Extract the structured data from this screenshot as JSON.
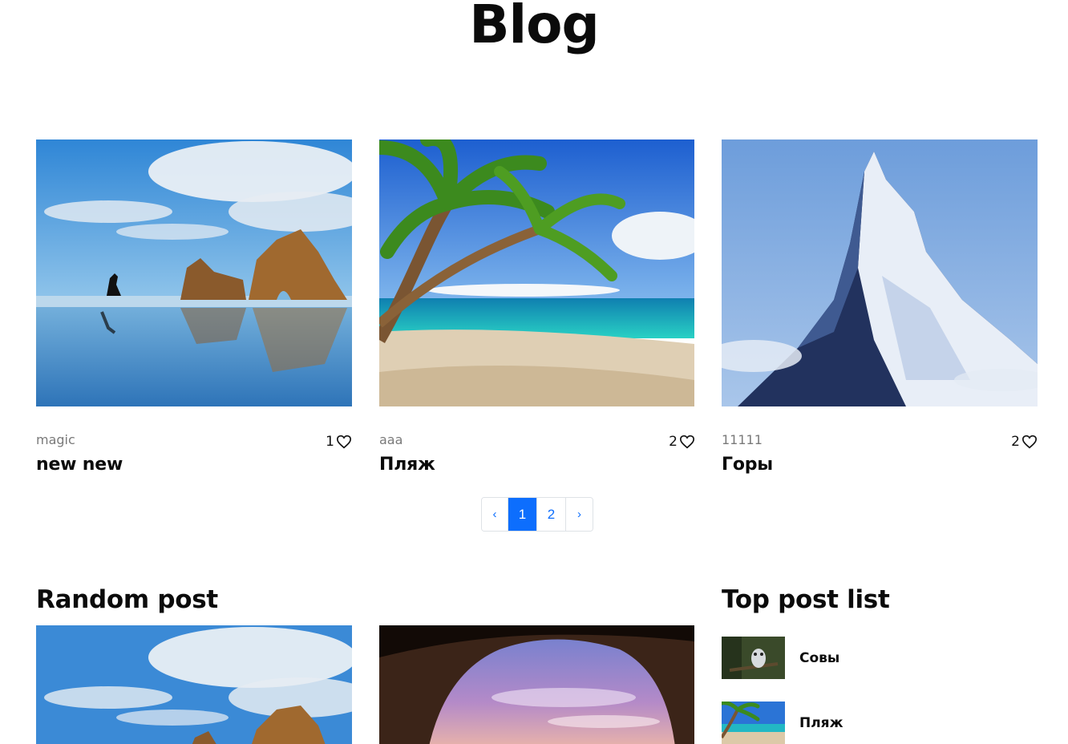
{
  "page": {
    "title": "Blog"
  },
  "posts": [
    {
      "category": "magic",
      "likes": "1",
      "title": "new new",
      "image": "beach-rocks-runner"
    },
    {
      "category": "aaa",
      "likes": "2",
      "title": "Пляж",
      "image": "palm-beach"
    },
    {
      "category": "11111",
      "likes": "2",
      "title": "Горы",
      "image": "snowy-mountain"
    }
  ],
  "pagination": {
    "prev": "‹",
    "pages": [
      "1",
      "2"
    ],
    "current": "1",
    "next": "›"
  },
  "random_post": {
    "heading": "Random post"
  },
  "top_posts": {
    "heading": "Top post list",
    "items": [
      {
        "title": "Совы",
        "image": "owl"
      },
      {
        "title": "Пляж",
        "image": "palm-beach"
      }
    ]
  },
  "colors": {
    "accent": "#0d6efd",
    "category_text": "#7a7a7a"
  },
  "icons": {
    "like": "heart-outline-icon"
  }
}
